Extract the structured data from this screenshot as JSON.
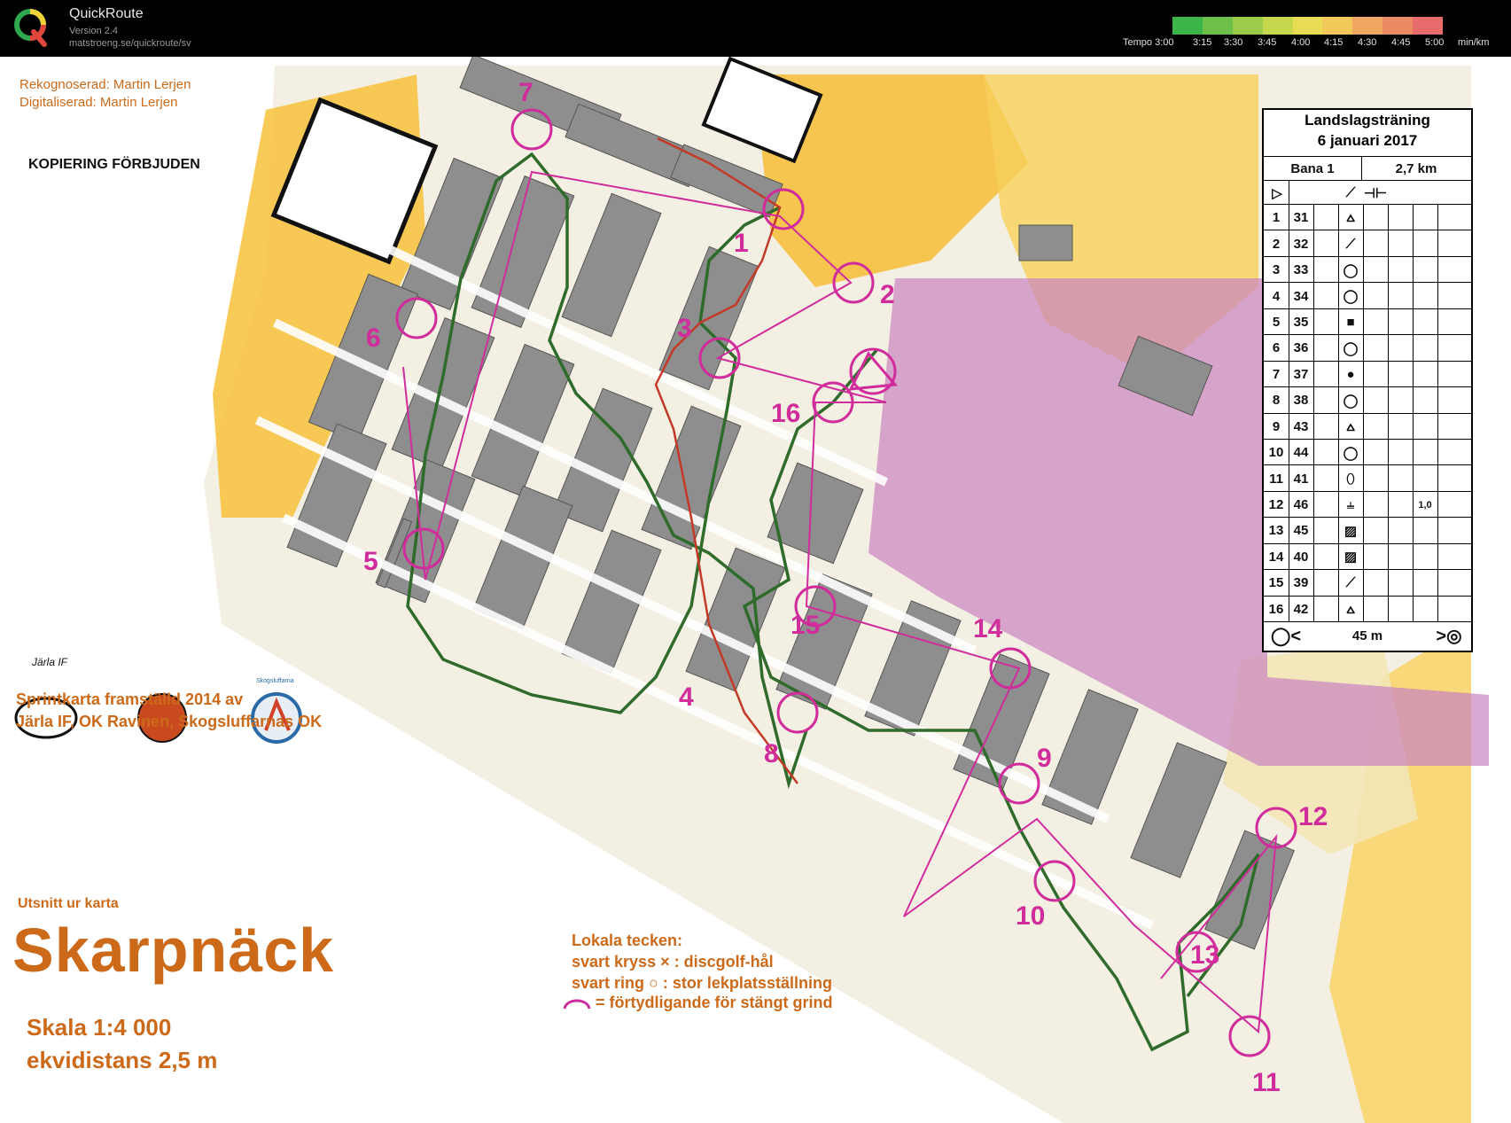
{
  "app": {
    "title": "QuickRoute",
    "version": "Version 2.4",
    "url": "matstroeng.se/quickroute/sv",
    "logo_icon": "quickroute-q-logo-icon"
  },
  "tempo_scale": {
    "labels": [
      "Tempo 3:00",
      "3:15",
      "3:30",
      "3:45",
      "4:00",
      "4:15",
      "4:30",
      "4:45",
      "5:00",
      "min/km"
    ],
    "colors": [
      "#3bb54a",
      "#6cc04a",
      "#9ccb4b",
      "#c6d64d",
      "#e8dc55",
      "#f2c85a",
      "#f0a860",
      "#ec8a66",
      "#e86c6c"
    ]
  },
  "map_texts": {
    "recon": "Rekognoserad: Martin Lerjen",
    "digital": "Digitaliserad: Martin Lerjen",
    "copy": "KOPIERING FÖRBJUDEN",
    "sprint_line1": "Sprintkarta framställd 2014 av",
    "sprint_line2": "Järla IF, OK Ravinen, Skogsluffarnas OK",
    "excerpt": "Utsnitt ur karta",
    "name": "Skarpnäck",
    "scale": "Skala 1:4 000",
    "contour": "ekvidistans 2,5 m",
    "local_title": "Lokala tecken:",
    "local_1": "svart kryss × : discgolf-hål",
    "local_2": "svart ring ○ : stor lekplatsställning",
    "local_3": "= förtydligande för stängt grind"
  },
  "club_logos": [
    "Järla IF",
    "OK Ravinen",
    "Skogsluffarna"
  ],
  "control_description": {
    "title": "Landslagsträning",
    "date": "6 januari 2017",
    "course": "Bana 1",
    "length": "2,7 km",
    "finish_distance": "45 m",
    "rows": [
      {
        "num": "1",
        "code": "31"
      },
      {
        "num": "2",
        "code": "32"
      },
      {
        "num": "3",
        "code": "33"
      },
      {
        "num": "4",
        "code": "34"
      },
      {
        "num": "5",
        "code": "35"
      },
      {
        "num": "6",
        "code": "36"
      },
      {
        "num": "7",
        "code": "37"
      },
      {
        "num": "8",
        "code": "38"
      },
      {
        "num": "9",
        "code": "43"
      },
      {
        "num": "10",
        "code": "44"
      },
      {
        "num": "11",
        "code": "41"
      },
      {
        "num": "12",
        "code": "46"
      },
      {
        "num": "13",
        "code": "45"
      },
      {
        "num": "14",
        "code": "40"
      },
      {
        "num": "15",
        "code": "39"
      },
      {
        "num": "16",
        "code": "42"
      }
    ],
    "extra_text": "1,0"
  },
  "controls": [
    "1",
    "2",
    "3",
    "4",
    "5",
    "6",
    "7",
    "8",
    "9",
    "10",
    "11",
    "12",
    "13",
    "14",
    "15",
    "16"
  ]
}
